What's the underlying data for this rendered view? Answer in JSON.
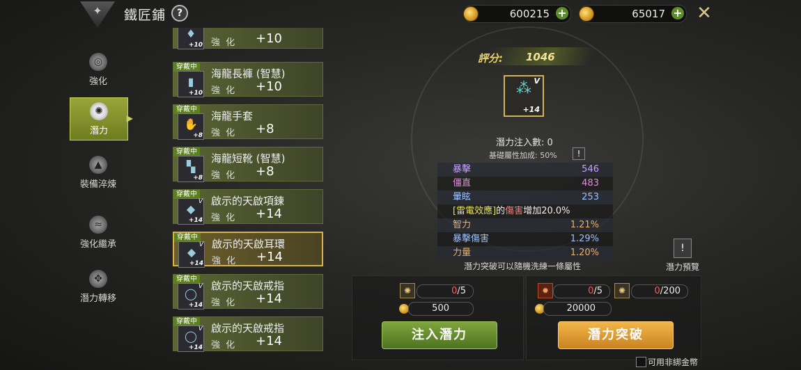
{
  "header": {
    "title": "鐵匠鋪",
    "help_icon": "question-icon",
    "currency_1": "600215",
    "currency_2": "65017",
    "colors": {
      "accent_green": "#7ea63c",
      "accent_gold": "#f2b64a"
    }
  },
  "nav": {
    "items": [
      {
        "label": "強化",
        "icon": "enhance-icon"
      },
      {
        "label": "潛力",
        "icon": "potential-icon",
        "active": true
      },
      {
        "label": "裝備淬煉",
        "icon": "anvil-icon"
      },
      {
        "label": "強化繼承",
        "icon": "inherit-icon"
      },
      {
        "label": "潛力轉移",
        "icon": "transfer-icon"
      }
    ]
  },
  "equipment": [
    {
      "tag": "",
      "name": "",
      "enh_label": "強 化",
      "enh_value": "+10",
      "level": "+10"
    },
    {
      "tag": "穿戴中",
      "name": "海龍長褲 (智慧)",
      "enh_label": "強 化",
      "enh_value": "+10",
      "level": "+10"
    },
    {
      "tag": "穿戴中",
      "name": "海龍手套",
      "enh_label": "強 化",
      "enh_value": "+8",
      "level": "+8"
    },
    {
      "tag": "穿戴中",
      "name": "海龍短靴 (智慧)",
      "enh_label": "強 化",
      "enh_value": "+8",
      "level": "+8"
    },
    {
      "tag": "穿戴中",
      "name": "啟示的天啟項鍊",
      "enh_label": "強 化",
      "enh_value": "+14",
      "level": "+14",
      "grade": "V"
    },
    {
      "tag": "穿戴中",
      "name": "啟示的天啟耳環",
      "enh_label": "強 化",
      "enh_value": "+14",
      "level": "+14",
      "grade": "V",
      "selected": true
    },
    {
      "tag": "穿戴中",
      "name": "啟示的天啟戒指",
      "enh_label": "強 化",
      "enh_value": "+14",
      "level": "+14",
      "grade": "V"
    },
    {
      "tag": "穿戴中",
      "name": "啟示的天啟戒指",
      "enh_label": "強 化",
      "enh_value": "+14",
      "level": "+14",
      "grade": "V"
    }
  ],
  "detail": {
    "score_label": "評分:",
    "score_value": "1046",
    "item_level": "+14",
    "item_grade": "V",
    "inject_count": "潛力注入數: 0",
    "base_bonus": "基礎屬性加成: 50%",
    "stats": [
      {
        "name": "暴擊",
        "value": "546",
        "color": "purple"
      },
      {
        "name": "僵直",
        "value": "483",
        "color": "pink"
      },
      {
        "name": "暈眩",
        "value": "253",
        "color": "blue"
      }
    ],
    "special_prefix": "[雷電效應]",
    "special_mid": "的",
    "special_dmg": "傷害",
    "special_suffix": "增加20.0%",
    "potentials": [
      {
        "name": "智力",
        "value": "1.21%",
        "color": "orange"
      },
      {
        "name": "暴擊傷害",
        "value": "1.29%",
        "color": "blue"
      },
      {
        "name": "力量",
        "value": "1.20%",
        "color": "orange"
      }
    ],
    "hint": "潛力突破可以隨機洗練一條屬性",
    "preview_label": "潛力預覽"
  },
  "inject_panel": {
    "stone_current": "0",
    "stone_max": "/5",
    "gold_cost": "500",
    "button": "注入潛力"
  },
  "break_panel": {
    "stone_current": "0",
    "stone_max": "/5",
    "material_current": "0",
    "material_max": "/200",
    "gold_cost": "20000",
    "button": "潛力突破"
  },
  "footer": {
    "unbound_label": "可用非綁金幣"
  }
}
